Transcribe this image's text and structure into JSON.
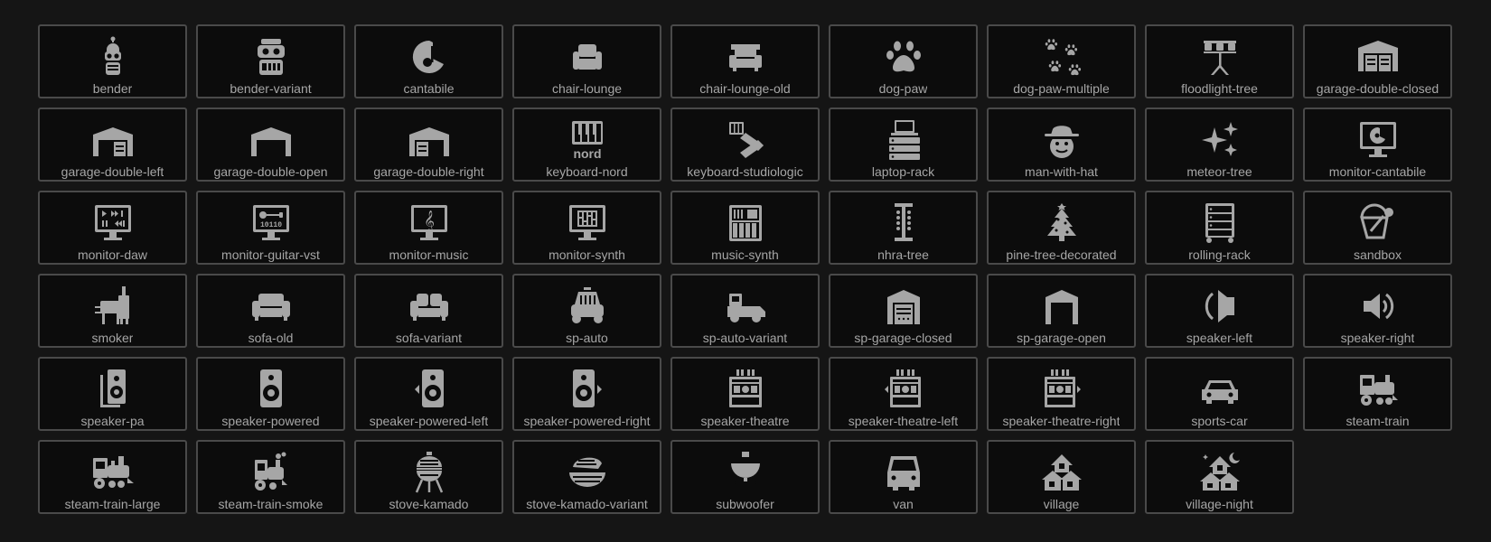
{
  "colors": {
    "background": "#151515",
    "tile_background": "#0c0c0c",
    "tile_border": "#4a4a4a",
    "icon_and_text": "#a6a6a6"
  },
  "icons": [
    {
      "label": "bender",
      "icon": "bender-icon"
    },
    {
      "label": "bender-variant",
      "icon": "bender-variant-icon"
    },
    {
      "label": "cantabile",
      "icon": "cantabile-icon"
    },
    {
      "label": "chair-lounge",
      "icon": "chair-lounge-icon"
    },
    {
      "label": "chair-lounge-old",
      "icon": "chair-lounge-old-icon"
    },
    {
      "label": "dog-paw",
      "icon": "dog-paw-icon"
    },
    {
      "label": "dog-paw-multiple",
      "icon": "dog-paw-multiple-icon"
    },
    {
      "label": "floodlight-tree",
      "icon": "floodlight-tree-icon"
    },
    {
      "label": "garage-double-closed",
      "icon": "garage-double-closed-icon"
    },
    {
      "label": "garage-double-left",
      "icon": "garage-double-left-icon"
    },
    {
      "label": "garage-double-open",
      "icon": "garage-double-open-icon"
    },
    {
      "label": "garage-double-right",
      "icon": "garage-double-right-icon"
    },
    {
      "label": "keyboard-nord",
      "icon": "keyboard-nord-icon"
    },
    {
      "label": "keyboard-studiologic",
      "icon": "keyboard-studiologic-icon"
    },
    {
      "label": "laptop-rack",
      "icon": "laptop-rack-icon"
    },
    {
      "label": "man-with-hat",
      "icon": "man-with-hat-icon"
    },
    {
      "label": "meteor-tree",
      "icon": "meteor-tree-icon"
    },
    {
      "label": "monitor-cantabile",
      "icon": "monitor-cantabile-icon"
    },
    {
      "label": "monitor-daw",
      "icon": "monitor-daw-icon"
    },
    {
      "label": "monitor-guitar-vst",
      "icon": "monitor-guitar-vst-icon"
    },
    {
      "label": "monitor-music",
      "icon": "monitor-music-icon"
    },
    {
      "label": "monitor-synth",
      "icon": "monitor-synth-icon"
    },
    {
      "label": "music-synth",
      "icon": "music-synth-icon"
    },
    {
      "label": "nhra-tree",
      "icon": "nhra-tree-icon"
    },
    {
      "label": "pine-tree-decorated",
      "icon": "pine-tree-decorated-icon"
    },
    {
      "label": "rolling-rack",
      "icon": "rolling-rack-icon"
    },
    {
      "label": "sandbox",
      "icon": "sandbox-icon"
    },
    {
      "label": "smoker",
      "icon": "smoker-icon"
    },
    {
      "label": "sofa-old",
      "icon": "sofa-old-icon"
    },
    {
      "label": "sofa-variant",
      "icon": "sofa-variant-icon"
    },
    {
      "label": "sp-auto",
      "icon": "sp-auto-icon"
    },
    {
      "label": "sp-auto-variant",
      "icon": "sp-auto-variant-icon"
    },
    {
      "label": "sp-garage-closed",
      "icon": "sp-garage-closed-icon"
    },
    {
      "label": "sp-garage-open",
      "icon": "sp-garage-open-icon"
    },
    {
      "label": "speaker-left",
      "icon": "speaker-left-icon"
    },
    {
      "label": "speaker-right",
      "icon": "speaker-right-icon"
    },
    {
      "label": "speaker-pa",
      "icon": "speaker-pa-icon"
    },
    {
      "label": "speaker-powered",
      "icon": "speaker-powered-icon"
    },
    {
      "label": "speaker-powered-left",
      "icon": "speaker-powered-left-icon"
    },
    {
      "label": "speaker-powered-right",
      "icon": "speaker-powered-right-icon"
    },
    {
      "label": "speaker-theatre",
      "icon": "speaker-theatre-icon"
    },
    {
      "label": "speaker-theatre-left",
      "icon": "speaker-theatre-left-icon"
    },
    {
      "label": "speaker-theatre-right",
      "icon": "speaker-theatre-right-icon"
    },
    {
      "label": "sports-car",
      "icon": "sports-car-icon"
    },
    {
      "label": "steam-train",
      "icon": "steam-train-icon"
    },
    {
      "label": "steam-train-large",
      "icon": "steam-train-large-icon"
    },
    {
      "label": "steam-train-smoke",
      "icon": "steam-train-smoke-icon"
    },
    {
      "label": "stove-kamado",
      "icon": "stove-kamado-icon"
    },
    {
      "label": "stove-kamado-variant",
      "icon": "stove-kamado-variant-icon"
    },
    {
      "label": "subwoofer",
      "icon": "subwoofer-icon"
    },
    {
      "label": "van",
      "icon": "van-icon"
    },
    {
      "label": "village",
      "icon": "village-icon"
    },
    {
      "label": "village-night",
      "icon": "village-night-icon"
    }
  ]
}
